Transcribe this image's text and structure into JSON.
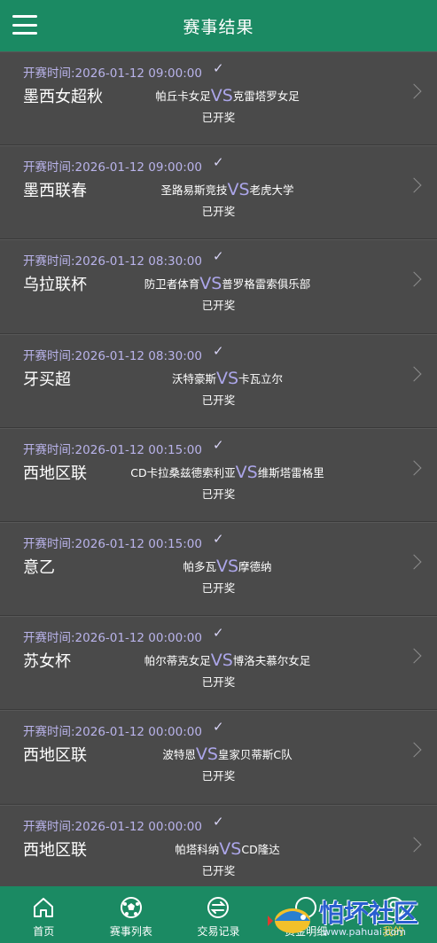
{
  "header": {
    "title": "赛事结果",
    "menu_icon": "menu-icon"
  },
  "matches": [
    {
      "time": "开赛时间:2026-01-12 09:00:00",
      "check": "✓",
      "league": "墨西女超秋",
      "home": "帕丘卡女足",
      "vs": "VS",
      "away": "克雷塔罗女足",
      "status": "已开奖"
    },
    {
      "time": "开赛时间:2026-01-12 09:00:00",
      "check": "✓",
      "league": "墨西联春",
      "home": "圣路易斯竞技",
      "vs": "VS",
      "away": "老虎大学",
      "status": "已开奖"
    },
    {
      "time": "开赛时间:2026-01-12 08:30:00",
      "check": "✓",
      "league": "乌拉联杯",
      "home": "防卫者体育",
      "vs": "VS",
      "away": "普罗格雷索俱乐部",
      "status": "已开奖"
    },
    {
      "time": "开赛时间:2026-01-12 08:30:00",
      "check": "✓",
      "league": "牙买超",
      "home": "沃特豪斯",
      "vs": "VS",
      "away": "卡瓦立尔",
      "status": "已开奖"
    },
    {
      "time": "开赛时间:2026-01-12 00:15:00",
      "check": "✓",
      "league": "西地区联",
      "home": "CD卡拉桑兹德索利亚",
      "vs": "VS",
      "away": "维斯塔雷格里",
      "status": "已开奖"
    },
    {
      "time": "开赛时间:2026-01-12 00:15:00",
      "check": "✓",
      "league": "意乙",
      "home": "帕多瓦",
      "vs": "VS",
      "away": "摩德纳",
      "status": "已开奖"
    },
    {
      "time": "开赛时间:2026-01-12 00:00:00",
      "check": "✓",
      "league": "苏女杯",
      "home": "帕尔蒂克女足",
      "vs": "VS",
      "away": "博洛夫慕尔女足",
      "status": "已开奖"
    },
    {
      "time": "开赛时间:2026-01-12 00:00:00",
      "check": "✓",
      "league": "西地区联",
      "home": "波特恩",
      "vs": "VS",
      "away": "皇家贝蒂斯C队",
      "status": "已开奖"
    },
    {
      "time": "开赛时间:2026-01-12 00:00:00",
      "check": "✓",
      "league": "西地区联",
      "home": "帕塔科纳",
      "vs": "VS",
      "away": "CD隆达",
      "status": "已开奖"
    }
  ],
  "tabbar": {
    "items": [
      {
        "label": "首页",
        "icon": "home-icon"
      },
      {
        "label": "赛事列表",
        "icon": "soccer-ball-icon"
      },
      {
        "label": "交易记录",
        "icon": "exchange-icon"
      },
      {
        "label": "资金明细",
        "icon": "wallet-icon"
      },
      {
        "label": "我的",
        "icon": "user-icon"
      }
    ]
  },
  "watermark": {
    "text": "怕坏社区",
    "url": "www.pahuai.com"
  },
  "colors": {
    "header": "#1b8a63",
    "background": "#4a4a4a",
    "time": "#b9b3ea",
    "vs": "#aca6ea"
  }
}
